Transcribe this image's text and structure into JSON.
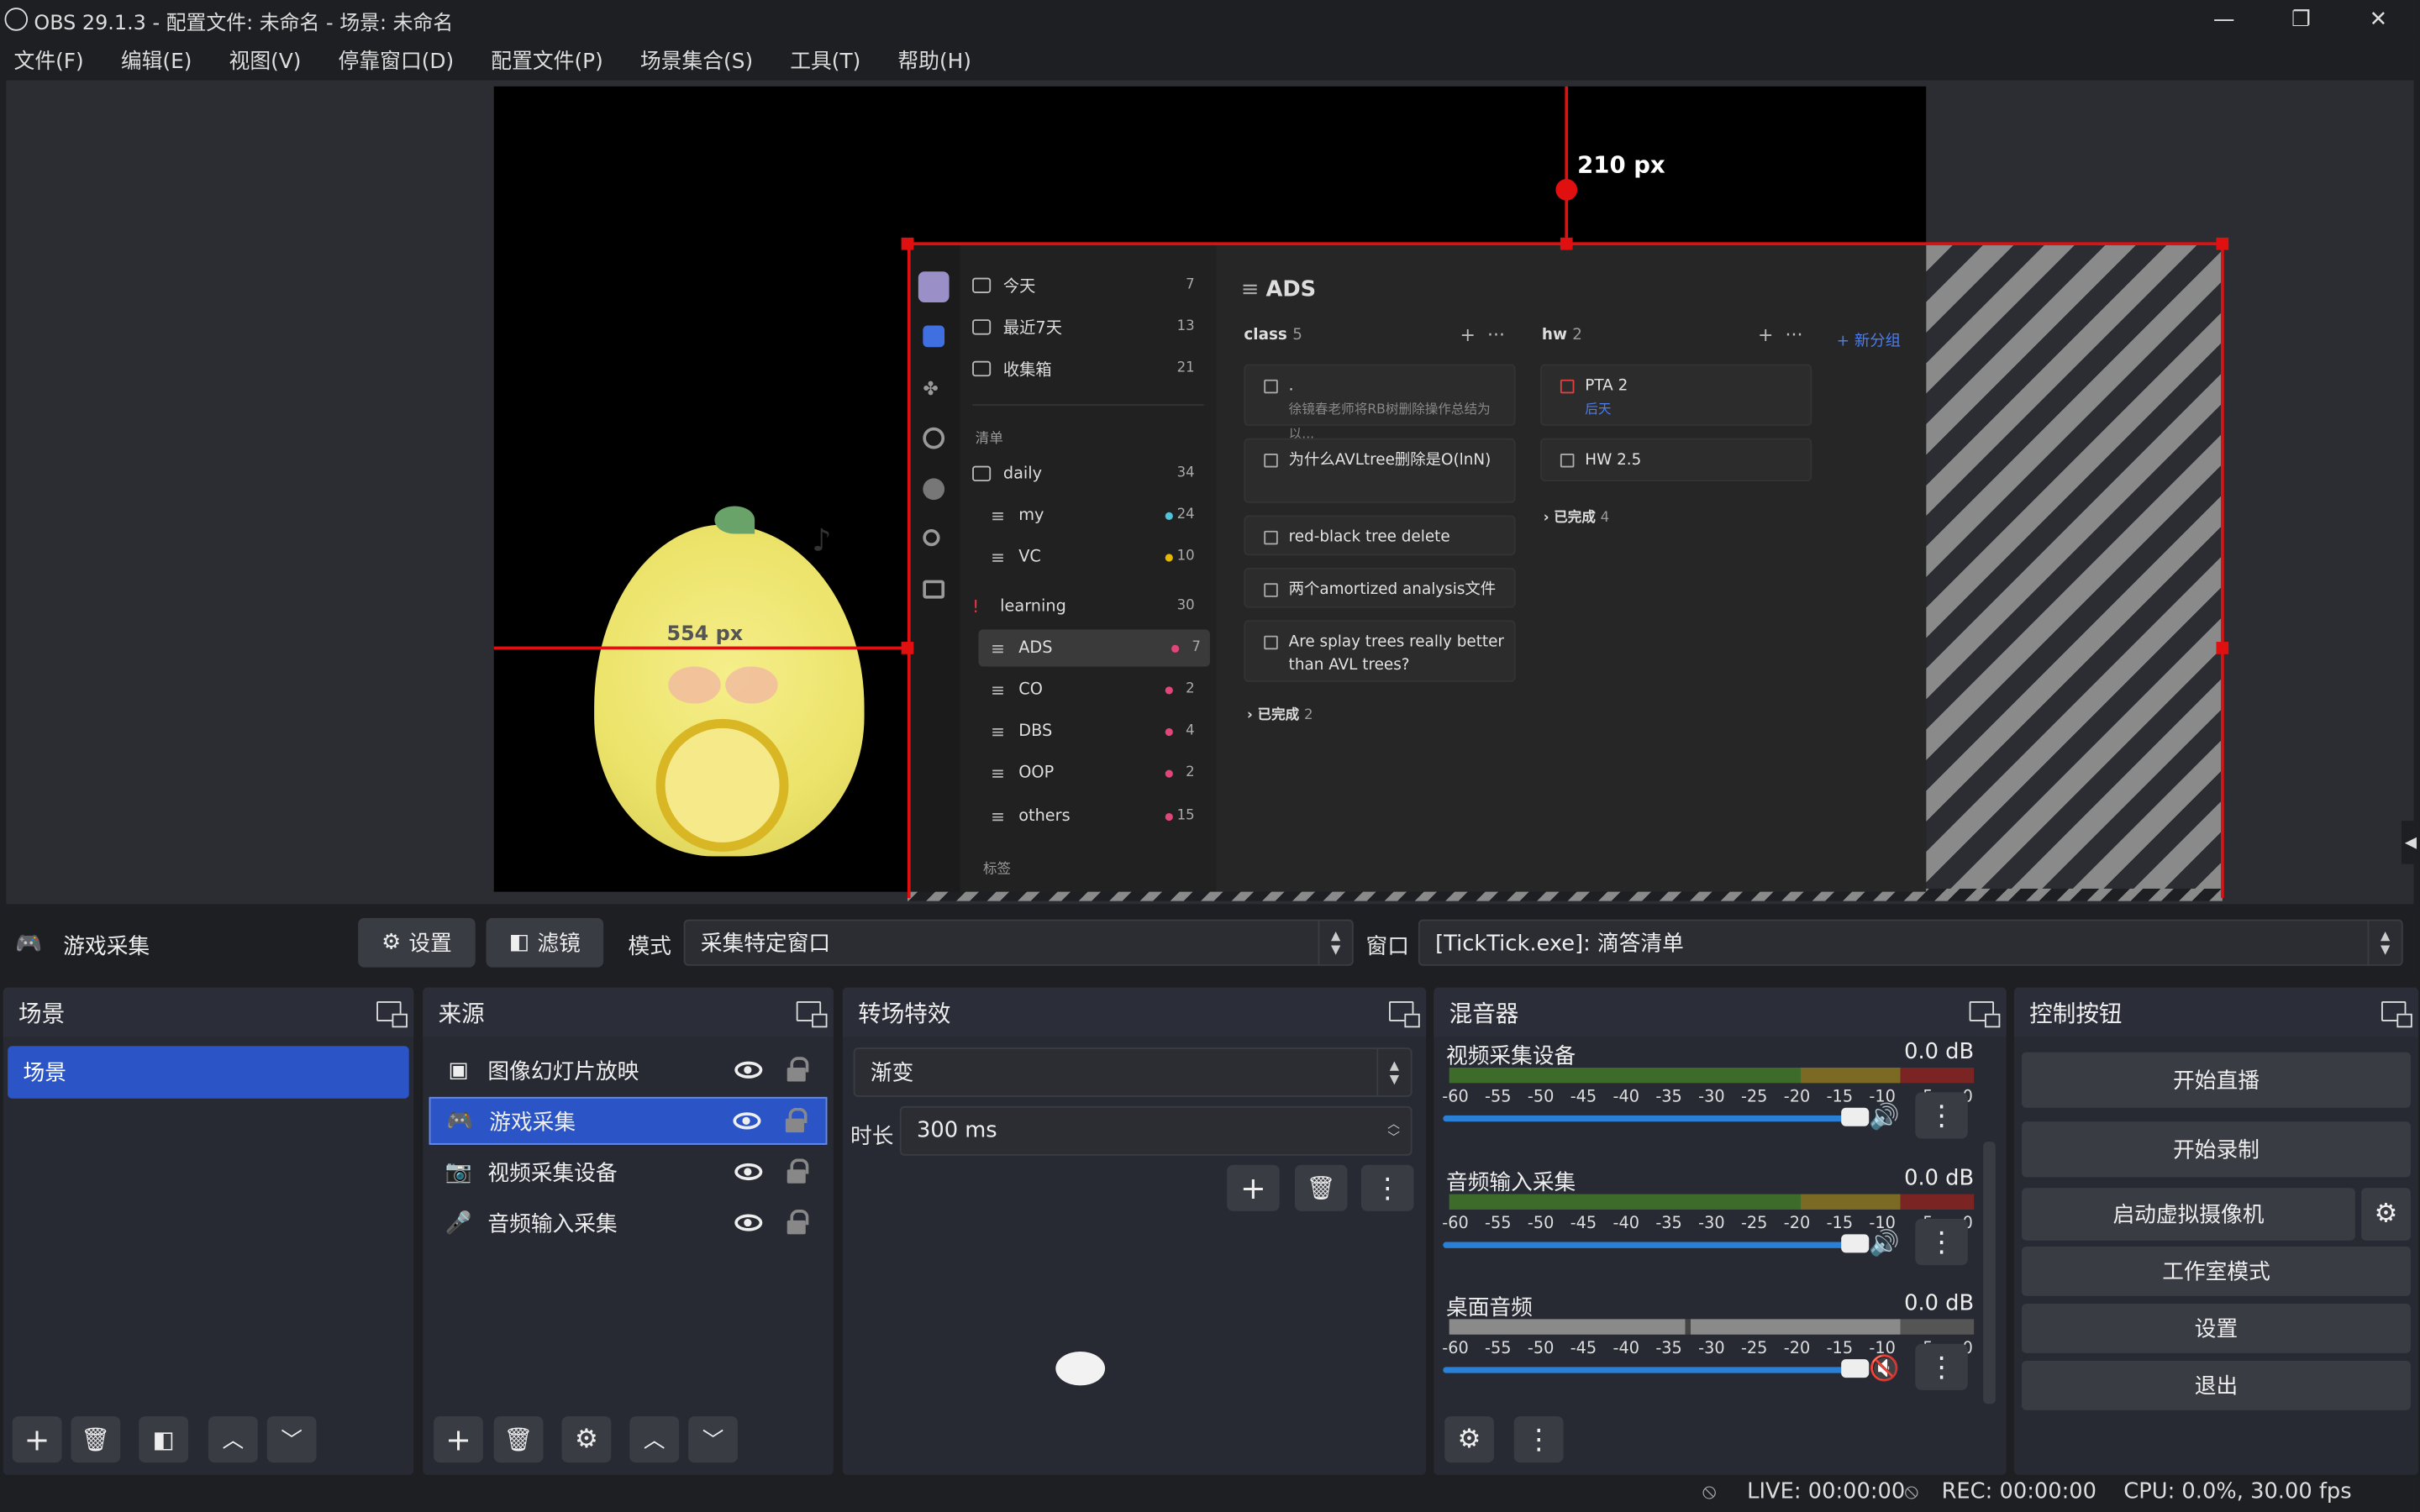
{
  "window": {
    "title": "OBS 29.1.3 - 配置文件: 未命名 - 场景: 未命名",
    "minimize": "—",
    "restore": "❐",
    "close": "✕"
  },
  "menu": [
    "文件(F)",
    "编辑(E)",
    "视图(V)",
    "停靠窗口(D)",
    "配置文件(P)",
    "场景集合(S)",
    "工具(T)",
    "帮助(H)"
  ],
  "preview": {
    "measure_top": "210 px",
    "measure_left": "554 px",
    "ticktick": {
      "smart_lists": [
        {
          "label": "今天",
          "count": "7"
        },
        {
          "label": "最近7天",
          "count": "13"
        },
        {
          "label": "收集箱",
          "count": "21"
        }
      ],
      "lists_header": "清单",
      "folders": [
        {
          "label": "daily",
          "count": "34"
        },
        {
          "label": "my",
          "count": "24",
          "dot": "#4fc3d9"
        },
        {
          "label": "VC",
          "count": "10",
          "dot": "#e6b800"
        },
        {
          "label": "learning",
          "count": "30"
        },
        {
          "label": "ADS",
          "count": "7",
          "dot": "#e0457b"
        },
        {
          "label": "CO",
          "count": "2",
          "dot": "#e0457b"
        },
        {
          "label": "DBS",
          "count": "4",
          "dot": "#e0457b"
        },
        {
          "label": "OOP",
          "count": "2",
          "dot": "#e0457b"
        },
        {
          "label": "others",
          "count": "15",
          "dot": "#e0457b"
        }
      ],
      "tags_header": "标签",
      "main_title": "ADS",
      "col1": {
        "name": "class",
        "count": "5",
        "done": "已完成",
        "done_count": "2"
      },
      "col2": {
        "name": "hw",
        "count": "2",
        "done": "已完成",
        "done_count": "4"
      },
      "new_group": "+ 新分组",
      "tasks1": [
        {
          "title": ".",
          "sub": "徐镜春老师将RB树删除操作总结为以..."
        },
        {
          "title": "为什么AVLtree删除是O(lnN)",
          "sub": ""
        },
        {
          "title": "red-black tree delete",
          "sub": ""
        },
        {
          "title": "两个amortized analysis文件",
          "sub": ""
        },
        {
          "title": "Are splay trees really better than AVL trees?",
          "sub": ""
        }
      ],
      "tasks2": [
        {
          "title": "PTA 2",
          "sub": "后天"
        },
        {
          "title": "HW 2.5",
          "sub": ""
        }
      ]
    }
  },
  "props": {
    "source_name": "游戏采集",
    "settings_label": "设置",
    "filters_label": "滤镜",
    "mode_label": "模式",
    "mode_value": "采集特定窗口",
    "window_label": "窗口",
    "window_value": "[TickTick.exe]: 滴答清单"
  },
  "scenes": {
    "title": "场景",
    "items": [
      "场景"
    ]
  },
  "sources": {
    "title": "来源",
    "items": [
      {
        "label": "图像幻灯片放映",
        "icon": "slideshow-icon"
      },
      {
        "label": "游戏采集",
        "icon": "gamepad-icon"
      },
      {
        "label": "视频采集设备",
        "icon": "camera-icon"
      },
      {
        "label": "音频输入采集",
        "icon": "microphone-icon"
      }
    ]
  },
  "transitions": {
    "title": "转场特效",
    "type": "渐变",
    "duration_label": "时长",
    "duration": "300 ms"
  },
  "mixer": {
    "title": "混音器",
    "channels": [
      {
        "name": "视频采集设备",
        "db": "0.0 dB",
        "level": 1.0,
        "muted": false
      },
      {
        "name": "音频输入采集",
        "db": "0.0 dB",
        "level": 1.0,
        "muted": false
      },
      {
        "name": "桌面音频",
        "db": "0.0 dB",
        "level": 1.0,
        "muted": true
      }
    ],
    "scale": [
      "-60",
      "-55",
      "-50",
      "-45",
      "-40",
      "-35",
      "-30",
      "-25",
      "-20",
      "-15",
      "-10",
      "-5",
      "0"
    ]
  },
  "controls": {
    "title": "控制按钮",
    "start_stream": "开始直播",
    "start_record": "开始录制",
    "virtual_cam": "启动虚拟摄像机",
    "studio_mode": "工作室模式",
    "settings": "设置",
    "exit": "退出"
  },
  "status": {
    "live": "LIVE: 00:00:00",
    "rec": "REC: 00:00:00",
    "cpu": "CPU: 0.0%, 30.00 fps"
  },
  "colors": {
    "accent": "#2f5bd0",
    "selected": "#2b55c6",
    "red": "#e01010",
    "fader": "#2a7fd6"
  }
}
